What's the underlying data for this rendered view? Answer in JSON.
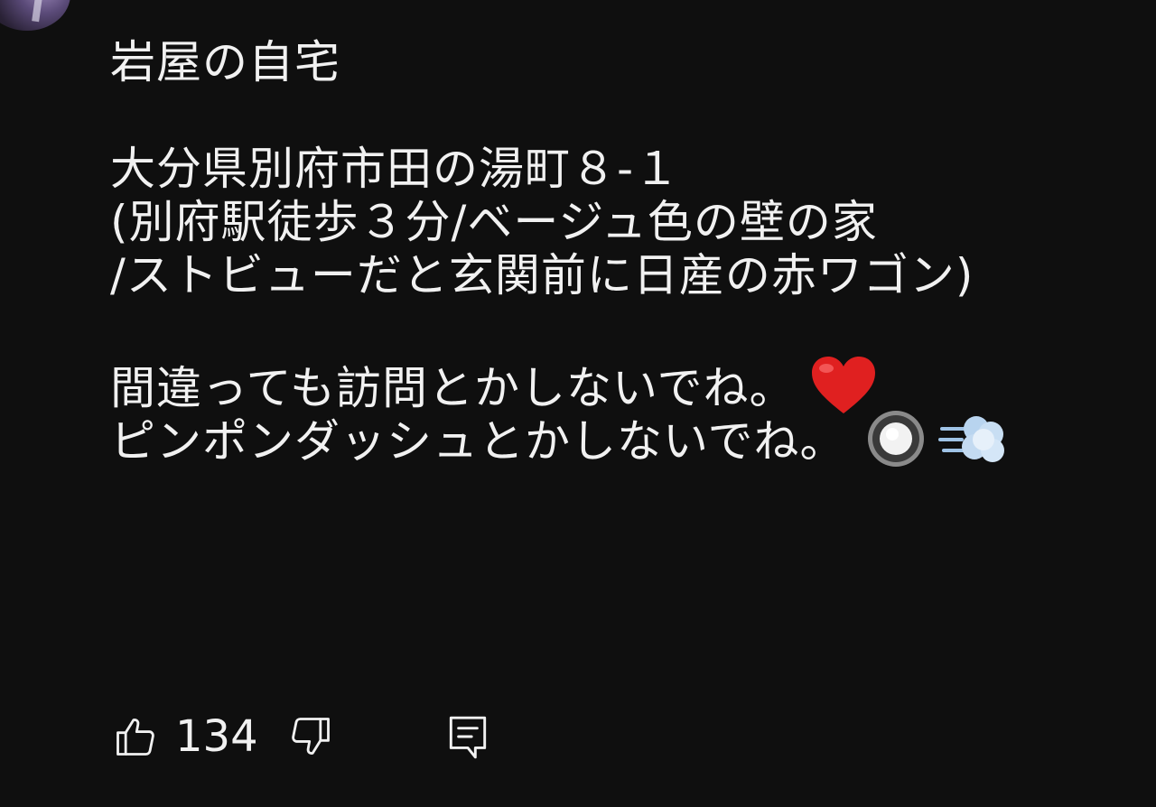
{
  "comment": {
    "author_line": "",
    "lines": [
      "岩屋の自宅",
      "",
      "大分県別府市田の湯町８‐１",
      "(別府駅徒歩３分/ベージュ色の壁の家",
      "/ストビューだと玄関前に日産の赤ワゴン)",
      "",
      "間違っても訪問とかしないでね。",
      "ピンポンダッシュとかしないでね。"
    ],
    "line7_emoji": "heart-emoji",
    "line8_emojis": [
      "radio-button-emoji",
      "dash-emoji"
    ]
  },
  "actions": {
    "like_count": "134",
    "like_icon": "thumbs-up-icon",
    "dislike_icon": "thumbs-down-icon",
    "reply_icon": "comment-reply-icon"
  },
  "colors": {
    "background": "#0f0f0f",
    "text": "#f1f1f1",
    "heart": "#e02020"
  }
}
